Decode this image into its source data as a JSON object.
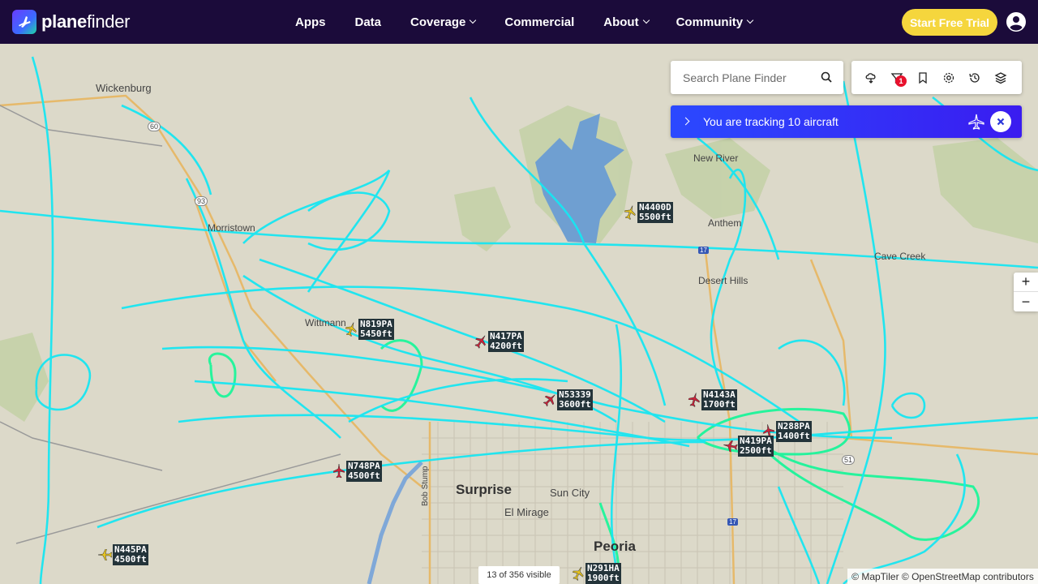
{
  "brand": {
    "name_bold": "plane",
    "name_light": "finder"
  },
  "nav": {
    "items": [
      {
        "label": "Apps",
        "dropdown": false
      },
      {
        "label": "Data",
        "dropdown": false
      },
      {
        "label": "Coverage",
        "dropdown": true
      },
      {
        "label": "Commercial",
        "dropdown": false
      },
      {
        "label": "About",
        "dropdown": true
      },
      {
        "label": "Community",
        "dropdown": true
      }
    ],
    "cta": "Start Free Trial"
  },
  "search": {
    "placeholder": "Search Plane Finder"
  },
  "toolbar": {
    "buttons": [
      "weather-icon",
      "filter-icon",
      "bookmark-icon",
      "settings-icon",
      "history-icon",
      "layers-icon"
    ],
    "filter_badge": "1"
  },
  "tracking": {
    "text": "You are tracking 10 aircraft"
  },
  "places": {
    "wickenburg": "Wickenburg",
    "morristown": "Morristown",
    "wittmann": "Wittmann",
    "new_river": "New River",
    "anthem": "Anthem",
    "cave_creek": "Cave Creek",
    "desert_hills": "Desert Hills",
    "surprise": "Surprise",
    "sun_city": "Sun City",
    "el_mirage": "El Mirage",
    "peoria": "Peoria",
    "bob_stump": "Bob Stump",
    "hwy_60": "60",
    "hwy_93": "93",
    "hwy_51": "51",
    "hwy_17a": "17",
    "hwy_17b": "17"
  },
  "aircraft": [
    {
      "callsign": "N4400D",
      "altitude": "5500ft",
      "color": "#e8c51f"
    },
    {
      "callsign": "N819PA",
      "altitude": "5450ft",
      "color": "#e8c51f"
    },
    {
      "callsign": "N417PA",
      "altitude": "4200ft",
      "color": "#d0223a"
    },
    {
      "callsign": "N53339",
      "altitude": "3600ft",
      "color": "#d0223a"
    },
    {
      "callsign": "N4143A",
      "altitude": "1700ft",
      "color": "#d0223a"
    },
    {
      "callsign": "N288PA",
      "altitude": "1400ft",
      "color": "#d0223a"
    },
    {
      "callsign": "N419PA",
      "altitude": "2500ft",
      "color": "#d0223a"
    },
    {
      "callsign": "N748PA",
      "altitude": "4500ft",
      "color": "#d0223a"
    },
    {
      "callsign": "N445PA",
      "altitude": "4500ft",
      "color": "#e8c51f"
    },
    {
      "callsign": "N291HA",
      "altitude": "1900ft",
      "color": "#e8c51f"
    }
  ],
  "map_controls": {
    "zoom_in": "+",
    "zoom_out": "−"
  },
  "footer": {
    "visible_count": "13 of 356 visible",
    "attribution": "© MapTiler © OpenStreetMap contributors"
  },
  "colors": {
    "nav_bg": "#1b0b3a",
    "cta": "#f5d63d",
    "track_primary": "#17e6f2",
    "track_secondary": "#1cf59a",
    "tracking_banner": "#2b49ff",
    "lake": "#6f9fd1",
    "park": "#b9c99e"
  }
}
